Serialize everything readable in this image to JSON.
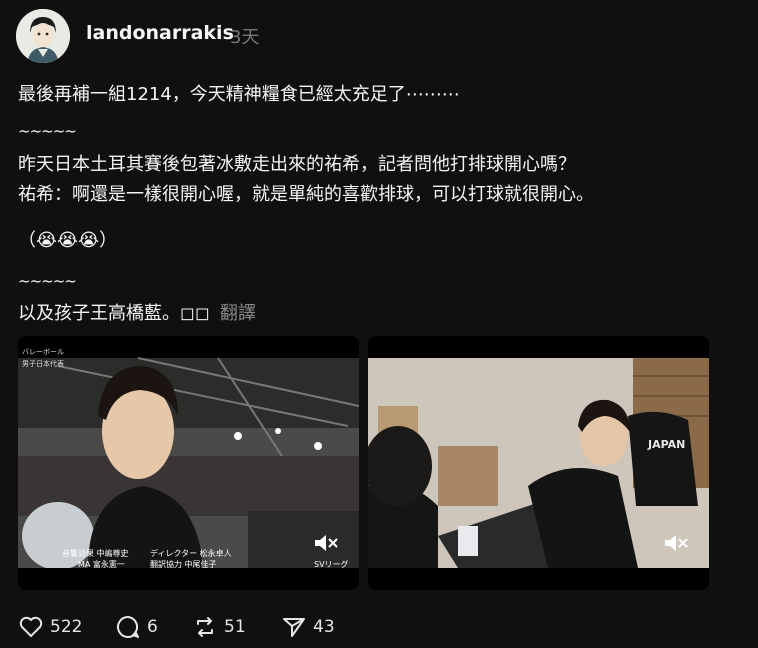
{
  "post": {
    "username": "landonarrakis",
    "time": "3天",
    "line1": "最後再補一組1214，今天精神糧食已經太充足了⋯⋯⋯",
    "tilde1": "~~~~~",
    "line2": "昨天日本土耳其賽後包著冰敷走出來的祐希，記者問他打排球開心嗎？",
    "line3": "祐希：啊還是一樣很開心喔，就是單純的喜歡排球，可以打球就很開心。",
    "line4": "（😭😭😭）",
    "tilde2": "~~~~~",
    "line5": "以及孩子王高橋藍。◻◻",
    "translate": "翻譯"
  },
  "media": [
    {
      "credits_left": "音響効果 中嶋尊史\nMA 富永憲一",
      "credits_right": "ディレクター 松永卓人\n翻訳協力 中尾佳子",
      "tag": "SVリーグ",
      "jersey": ""
    },
    {
      "jersey": "JAPAN"
    }
  ],
  "actions": {
    "likes": "522",
    "comments": "6",
    "reposts": "51",
    "shares": "43"
  },
  "colors": {
    "background": "#101010",
    "text": "#f3f5f7",
    "muted": "#777777"
  }
}
